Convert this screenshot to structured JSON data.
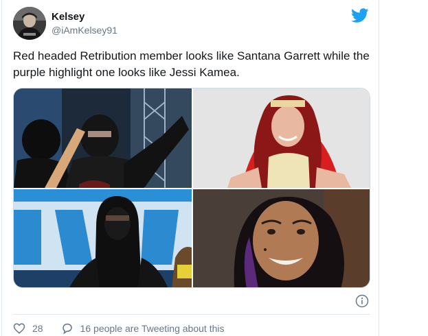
{
  "tweet": {
    "author": {
      "display_name": "Kelsey",
      "handle": "@iAmKelsey91"
    },
    "text": "Red headed Retribution member looks like Santana Garrett while the purple highlight one looks like Jessi Kamea.",
    "media": [
      {
        "name": "photo-masked-wrestlers-with-bat"
      },
      {
        "name": "photo-red-haired-woman-red-cape"
      },
      {
        "name": "photo-hooded-masked-figure"
      },
      {
        "name": "photo-smiling-woman-purple-highlights"
      }
    ],
    "stats": {
      "likes": "28",
      "tweeting_about": "16 people are Tweeting about this"
    }
  },
  "icons": {
    "brand": "twitter-bird-icon",
    "info": "info-icon",
    "like": "heart-icon",
    "reply": "speech-bubble-icon"
  },
  "colors": {
    "twitter_blue": "#1da1f2",
    "text": "#14171a",
    "muted": "#657786",
    "border": "#e1e8ed"
  }
}
